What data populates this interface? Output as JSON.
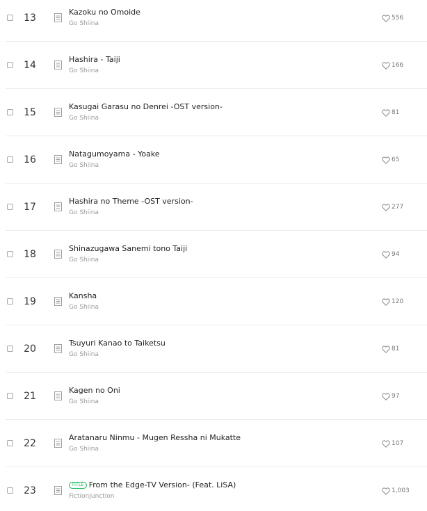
{
  "tracks": [
    {
      "number": "13",
      "title": "Kazoku no Omoide",
      "artist": "Go Shiina",
      "likes": "556",
      "badge": ""
    },
    {
      "number": "14",
      "title": "Hashira - Taiji",
      "artist": "Go Shiina",
      "likes": "166",
      "badge": ""
    },
    {
      "number": "15",
      "title": "Kasugai Garasu no Denrei -OST version-",
      "artist": "Go Shiina",
      "likes": "81",
      "badge": ""
    },
    {
      "number": "16",
      "title": "Natagumoyama - Yoake",
      "artist": "Go Shiina",
      "likes": "65",
      "badge": ""
    },
    {
      "number": "17",
      "title": "Hashira no Theme -OST version-",
      "artist": "Go Shiina",
      "likes": "277",
      "badge": ""
    },
    {
      "number": "18",
      "title": "Shinazugawa Sanemi tono Taiji",
      "artist": "Go Shiina",
      "likes": "94",
      "badge": ""
    },
    {
      "number": "19",
      "title": "Kansha",
      "artist": "Go Shiina",
      "likes": "120",
      "badge": ""
    },
    {
      "number": "20",
      "title": "Tsuyuri Kanao to Taiketsu",
      "artist": "Go Shiina",
      "likes": "81",
      "badge": ""
    },
    {
      "number": "21",
      "title": "Kagen no Oni",
      "artist": "Go Shiina",
      "likes": "97",
      "badge": ""
    },
    {
      "number": "22",
      "title": "Aratanaru Ninmu - Mugen Ressha ni Mukatte",
      "artist": "Go Shiina",
      "likes": "107",
      "badge": ""
    },
    {
      "number": "23",
      "title": "From the Edge-TV Version- (Feat. LiSA)",
      "artist": "FictionJunction",
      "likes": "1,003",
      "badge": "TITLE"
    }
  ],
  "icons": {
    "checkbox": "checkbox-icon",
    "lyrics": "lyrics-icon",
    "like": "heart-icon"
  },
  "colors": {
    "title_badge": "#18b858",
    "divider": "#ececec",
    "artist_text": "#9a9a9a"
  }
}
